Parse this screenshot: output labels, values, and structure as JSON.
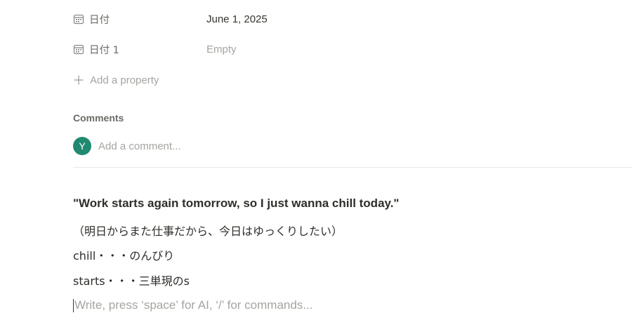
{
  "properties": [
    {
      "icon": "calendar-icon",
      "label": "日付",
      "value": "June 1, 2025",
      "empty": false
    },
    {
      "icon": "calendar-icon",
      "label": "日付 1",
      "value": "Empty",
      "empty": true
    }
  ],
  "add_property": {
    "icon": "plus-icon",
    "label": "Add a property"
  },
  "comments": {
    "heading": "Comments",
    "avatar_initial": "Y",
    "avatar_color": "#1f8a70",
    "input_placeholder": "Add a comment..."
  },
  "content": {
    "quote": "\"Work starts again tomorrow, so I just wanna chill today.\"",
    "translation": "（明日からまた仕事だから、今日はゆっくりしたい）",
    "note_chill": "chill・・・のんびり",
    "note_starts": "starts・・・三単現のs"
  },
  "editor": {
    "placeholder": "Write, press ‘space’ for AI, ‘/’ for commands..."
  }
}
